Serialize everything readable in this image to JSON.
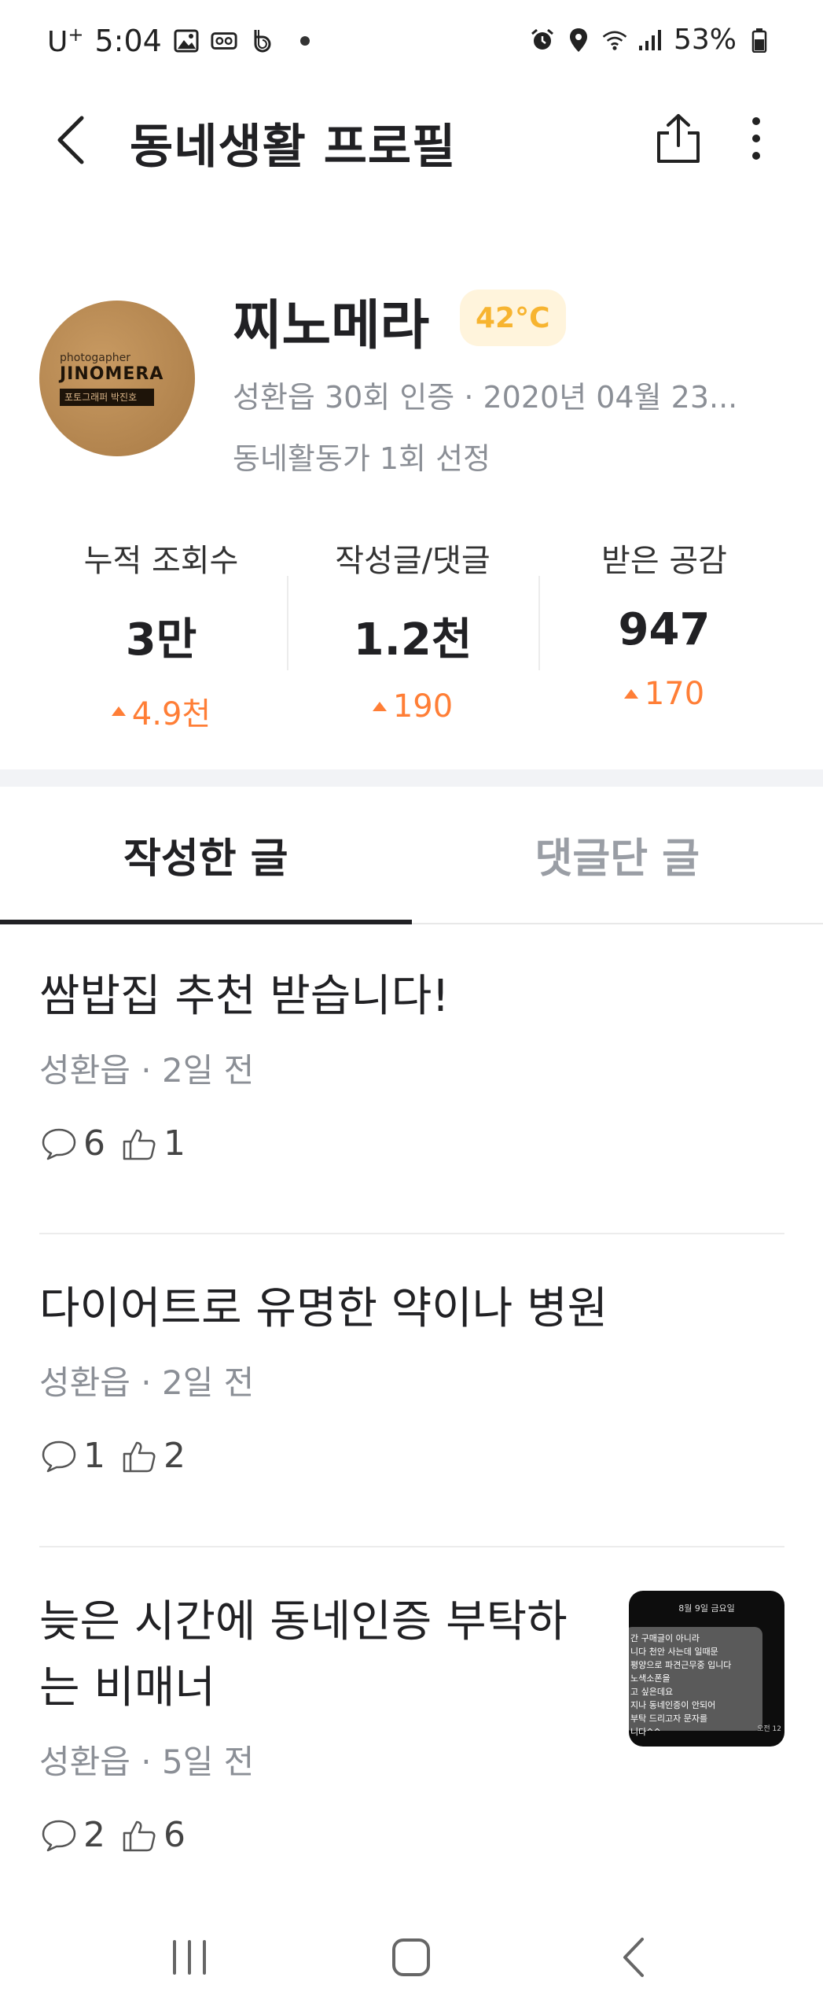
{
  "status_bar": {
    "carrier": "U",
    "carrier_sup": "+",
    "time": "5:04",
    "battery": "53%"
  },
  "header": {
    "title": "동네생활 프로필"
  },
  "profile": {
    "nickname": "찌노메라",
    "temperature": "42°C",
    "line1": "성환읍 30회 인증 · 2020년 04월 23...",
    "line2": "동네활동가 1회 선정",
    "avatar_line1": "photogapher",
    "avatar_line2": "JINOMERA",
    "avatar_line3": "포토그래퍼 박진호"
  },
  "stats": [
    {
      "label": "누적 조회수",
      "value": "3만",
      "delta": "4.9천"
    },
    {
      "label": "작성글/댓글",
      "value": "1.2천",
      "delta": "190"
    },
    {
      "label": "받은 공감",
      "value": "947",
      "delta": "170"
    }
  ],
  "tabs": [
    {
      "label": "작성한 글",
      "active": true
    },
    {
      "label": "댓글단 글",
      "active": false
    }
  ],
  "posts": [
    {
      "title": "쌈밥집 추천 받습니다!",
      "meta": "성환읍 · 2일 전",
      "comments": "6",
      "likes": "1"
    },
    {
      "title": "다이어트로 유명한 약이나 병원",
      "meta": "성환읍 · 2일 전",
      "comments": "1",
      "likes": "2"
    },
    {
      "title": "늦은 시간에 동네인증 부탁하는 비매너",
      "meta": "성환읍 · 5일 전",
      "comments": "2",
      "likes": "6"
    }
  ],
  "thumbnail": {
    "date": "8월 9일 금요일",
    "lines": [
      "간 구매글이 아니라",
      "니다 천안 사는데 일때문",
      "평양으로 파견근무중 입니다",
      "노색소폰을",
      "고 싶은데요",
      "지나 동네인증이 안되어",
      "부탁 드리고자 문자를",
      "니다^^"
    ],
    "time": "오전 12"
  },
  "icons": {
    "back": "chevron-left-icon",
    "share": "share-icon",
    "more": "more-vertical-icon",
    "comment": "comment-icon",
    "like": "thumbs-up-icon"
  },
  "colors": {
    "accent_orange": "#ff7e36",
    "temperature": "#f7b430",
    "muted_text": "#8b8f96"
  }
}
